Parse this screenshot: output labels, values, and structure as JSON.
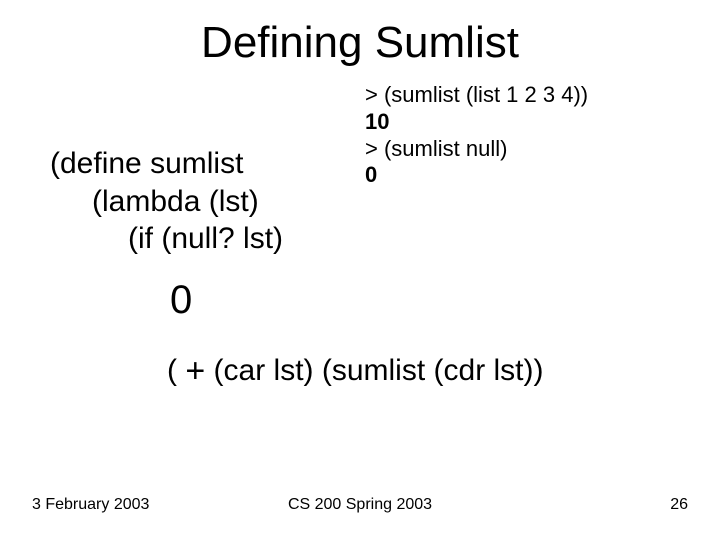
{
  "title": "Defining Sumlist",
  "definition": {
    "line1": "(define sumlist",
    "line2": "(lambda (lst)",
    "line3": "(if (null? lst)"
  },
  "zero": "0",
  "call": {
    "open": "( ",
    "plus": "+",
    "rest": "  (car lst) (sumlist (cdr lst))"
  },
  "repl": {
    "l1": "> (sumlist (list 1 2 3 4))",
    "l2": "10",
    "l3": "> (sumlist null)",
    "l4": "0"
  },
  "footer": {
    "left": "3 February 2003",
    "center": "CS 200 Spring 2003",
    "right": "26"
  }
}
